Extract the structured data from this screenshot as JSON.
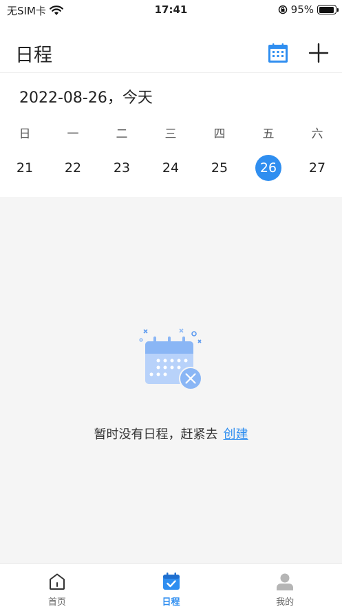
{
  "status_bar": {
    "carrier": "无SIM卡",
    "time": "17:41",
    "battery": "95%",
    "battery_level": 0.95
  },
  "header": {
    "title": "日程"
  },
  "date_line": "2022-08-26，今天",
  "week": {
    "weekdays": [
      "日",
      "一",
      "二",
      "三",
      "四",
      "五",
      "六"
    ],
    "days": [
      "21",
      "22",
      "23",
      "24",
      "25",
      "26",
      "27"
    ],
    "selected_day": "26"
  },
  "empty_state": {
    "message": "暂时没有日程，赶紧去",
    "link": "创建"
  },
  "tabs": [
    {
      "label": "首页",
      "icon": "home-icon"
    },
    {
      "label": "日程",
      "icon": "calendar-check-icon"
    },
    {
      "label": "我的",
      "icon": "user-icon"
    }
  ],
  "colors": {
    "accent": "#2f8ef0",
    "background": "#f5f5f5"
  }
}
